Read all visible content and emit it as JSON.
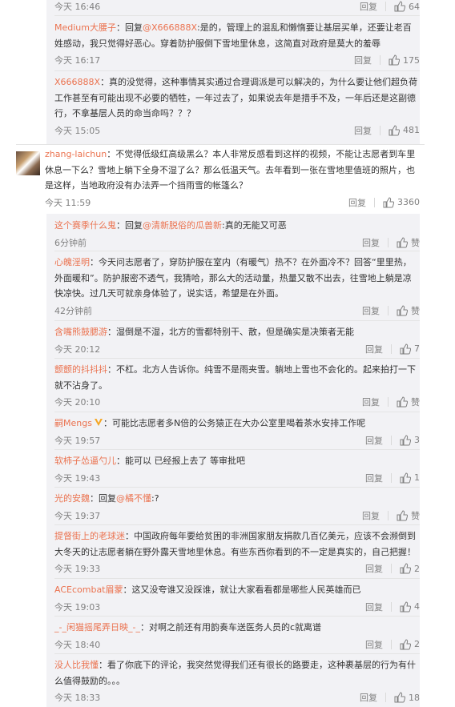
{
  "colors": {
    "username": "#eb7350",
    "meta": "#808080",
    "reply_bg": "#f2f2f5",
    "vip_badge": "#f5a623"
  },
  "labels": {
    "reply": "回复",
    "reply_prefix": "回复",
    "like_zan": "赞"
  },
  "top_replies": [
    {
      "time": "今天 16:46",
      "likes": "64"
    },
    {
      "user": "Medium大腰子",
      "reply_to": "@X666888X",
      "text_prefix": "：回复",
      "text": ":是的，管理上的混乱和懒惰要让基层买单，还要让老百姓感动，我只觉得好恶心。穿着防护服倒下雪地里休息，这简直对政府是莫大的羞辱",
      "time": "今天 16:17",
      "likes": "175"
    },
    {
      "user": "X666888X",
      "text": "：真的没觉得，这种事情其实通过合理调派是可以解决的，为什么要让他们超负荷工作甚至有可能出现不必要的牺牲，一年过去了，如果说去年是措手不及，一年后还是这副德行，不拿基层人员的命当命吗？？？",
      "time": "今天 15:05",
      "likes": "481"
    }
  ],
  "main_comment": {
    "user": "zhang-laichun",
    "text": "：不觉得低级红高级黑么？本人非常反感看到这样的视频，不能让志愿者到车里休息一下么？雪地上躺下全身不湿了么？那么低温天气。去年看到一张在雪地里值班的照片，也是这样，当地政府没有办法弄一个挡雨雪的帐篷么？",
    "time": "今天 11:59",
    "likes": "3360"
  },
  "sub_replies": [
    {
      "user": "这个赛季什么鬼",
      "text_prefix": "：回复",
      "reply_to": "@清新脱俗的瓜兽新",
      "text": ":真的无能又可恶",
      "time": "6分钟前",
      "likes": "赞"
    },
    {
      "user": "心魄淫明",
      "text": "：今天问志愿者了，穿防护服在室内（有暖气）热不？在外面冷不？回答“里里热，外面暖和”。防护服密不透气，我猜哈，那么大的活动量，热量又散不出去，往雪地上躺是凉快凉快。过几天可就亲身体验了，说实话，希望是在外面。",
      "time": "42分钟前",
      "likes": "赞"
    },
    {
      "user": "含嘴熊鼓腮游",
      "text": "：湿倒是不湿，北方的雪都特别干、散，但是确实是决策者无能",
      "time": "今天 20:12",
      "likes": "7"
    },
    {
      "user": "颤颤的抖抖抖",
      "text": "：不杠。北方人告诉你。纯雪不是雨夹雪。躺地上雪也不会化的。起来拍打一下就不沾身了。",
      "time": "今天 20:10",
      "likes": "赞"
    },
    {
      "user": "嗣Mengs",
      "vip": true,
      "text": "：可能比志愿者多N倍的公务猿正在大办公室里喝着茶水安排工作呢",
      "time": "今天 19:57",
      "likes": "3"
    },
    {
      "user": "软柿子怂逼勺儿",
      "text": "：能可以 已经报上去了 等审批吧",
      "time": "今天 19:43",
      "likes": "1"
    },
    {
      "user": "光的安魏",
      "text_prefix": "：回复",
      "reply_to": "@橘不懂",
      "text": ":?",
      "time": "今天 19:37",
      "likes": "赞"
    },
    {
      "user": "提督街上的老球迷",
      "text": "：中国政府每年要给贫困的非洲国家朋友捐款几百亿美元，应该不会濒倒到大冬天的让志愿者躺在野外露天雪地里休息。有些东西你看到的不一定是真实的，自己把握！",
      "time": "今天 19:33",
      "likes": "2"
    },
    {
      "user": "ACEcombat眉蒙",
      "text": "：这又没夸谁又没踩谁，就让大家看看都是哪些人民英雄而已",
      "time": "今天 19:03",
      "likes": "4"
    },
    {
      "user": "_-_闲猫摇尾弄日映_-_",
      "text": "：对啊之前还有用韵奏车送医务人员的c就离谱",
      "time": "今天 18:40",
      "likes": "2"
    },
    {
      "user": "没人比我懂",
      "text": "：看了你底下的评论，我突然觉得我们还有很长的路要走，这种裹基层的行为有什么值得鼓励的。。。",
      "time": "今天 18:33",
      "likes": "18"
    }
  ]
}
